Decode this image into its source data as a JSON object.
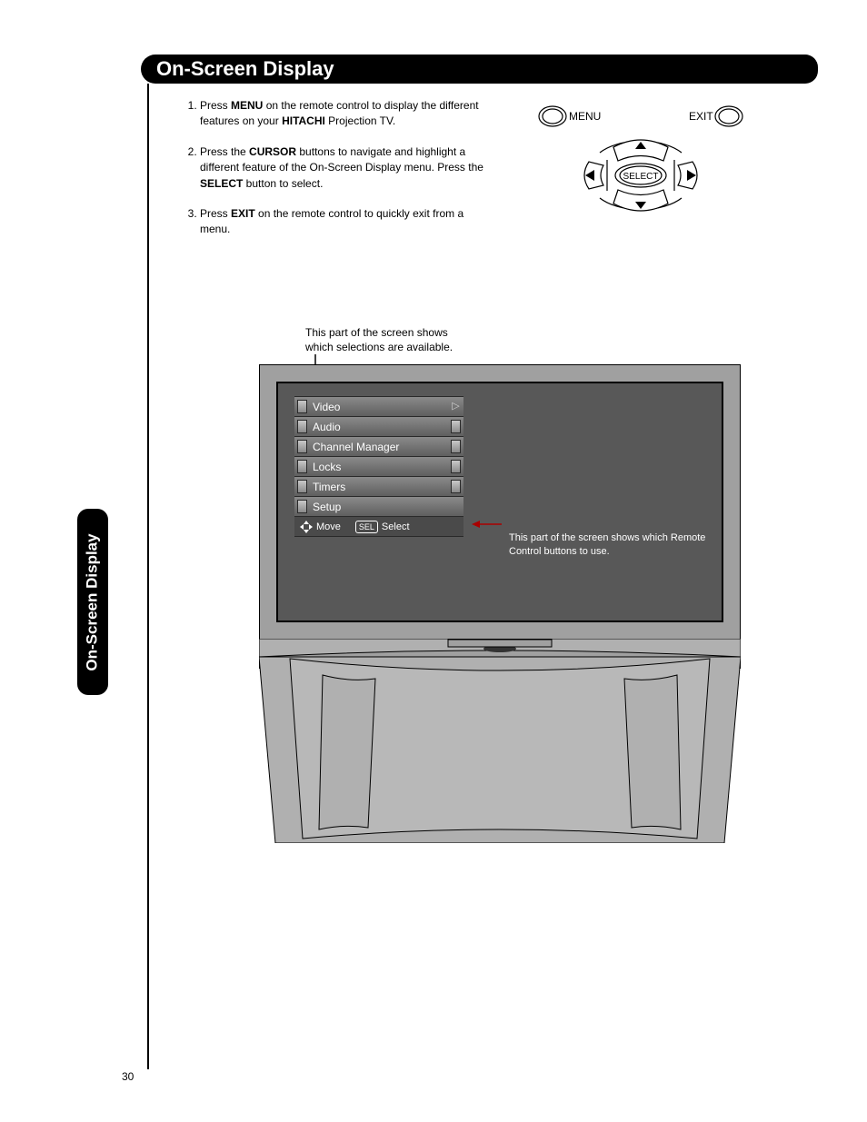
{
  "page_number": "30",
  "header": {
    "title": "On-Screen Display"
  },
  "side_tab": "On-Screen Display",
  "instructions": {
    "item1_pre": "Press ",
    "item1_b1": "MENU",
    "item1_mid": " on the remote control to display the different features on your ",
    "item1_b2": "HITACHI",
    "item1_post": " Projection TV.",
    "item2_pre": "Press the ",
    "item2_b1": "CURSOR",
    "item2_mid": " buttons to navigate and highlight a different feature of the On-Screen Display menu. Press the ",
    "item2_b2": "SELECT",
    "item2_post": " button to select.",
    "item3_pre": "Press ",
    "item3_b1": "EXIT",
    "item3_post": " on the remote control to quickly exit from a menu."
  },
  "remote": {
    "menu_label": "MENU",
    "exit_label": "EXIT",
    "select_label": "SELECT"
  },
  "caption_top": "This part of the screen shows which selections are available.",
  "caption_right": "This part of the screen shows which Remote Control buttons to use.",
  "osd_menu": {
    "items": [
      {
        "label": "Video",
        "selected": true
      },
      {
        "label": "Audio",
        "selected": false
      },
      {
        "label": "Channel Manager",
        "selected": false
      },
      {
        "label": "Locks",
        "selected": false
      },
      {
        "label": "Timers",
        "selected": false
      },
      {
        "label": "Setup",
        "selected": false
      }
    ],
    "hint_move": "Move",
    "hint_sel_pill": "SEL",
    "hint_select": "Select"
  }
}
